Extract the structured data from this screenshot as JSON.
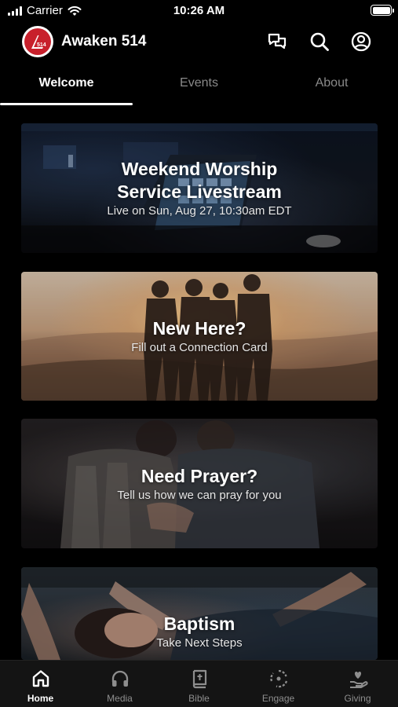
{
  "status_bar": {
    "carrier": "Carrier",
    "time": "10:26 AM"
  },
  "header": {
    "app_title": "Awaken 514",
    "logo_text": "514"
  },
  "tabs": [
    {
      "label": "Welcome",
      "active": true
    },
    {
      "label": "Events",
      "active": false
    },
    {
      "label": "About",
      "active": false
    }
  ],
  "cards": [
    {
      "title_line1": "Weekend Worship",
      "title_line2": "Service Livestream",
      "subtitle": "Live on Sun, Aug 27, 10:30am EDT"
    },
    {
      "title": "New Here?",
      "subtitle": "Fill out a Connection Card"
    },
    {
      "title": "Need Prayer?",
      "subtitle": "Tell us how we can pray for you"
    },
    {
      "title": "Baptism",
      "subtitle": "Take Next Steps"
    }
  ],
  "tab_bar": [
    {
      "label": "Home",
      "icon": "home-icon",
      "active": true
    },
    {
      "label": "Media",
      "icon": "headphones-icon",
      "active": false
    },
    {
      "label": "Bible",
      "icon": "bible-icon",
      "active": false
    },
    {
      "label": "Engage",
      "icon": "engage-icon",
      "active": false
    },
    {
      "label": "Giving",
      "icon": "giving-icon",
      "active": false
    }
  ],
  "colors": {
    "background": "#000000",
    "brand_red": "#c8202c",
    "inactive": "#8e8e8e",
    "tab_bar": "#141414"
  }
}
